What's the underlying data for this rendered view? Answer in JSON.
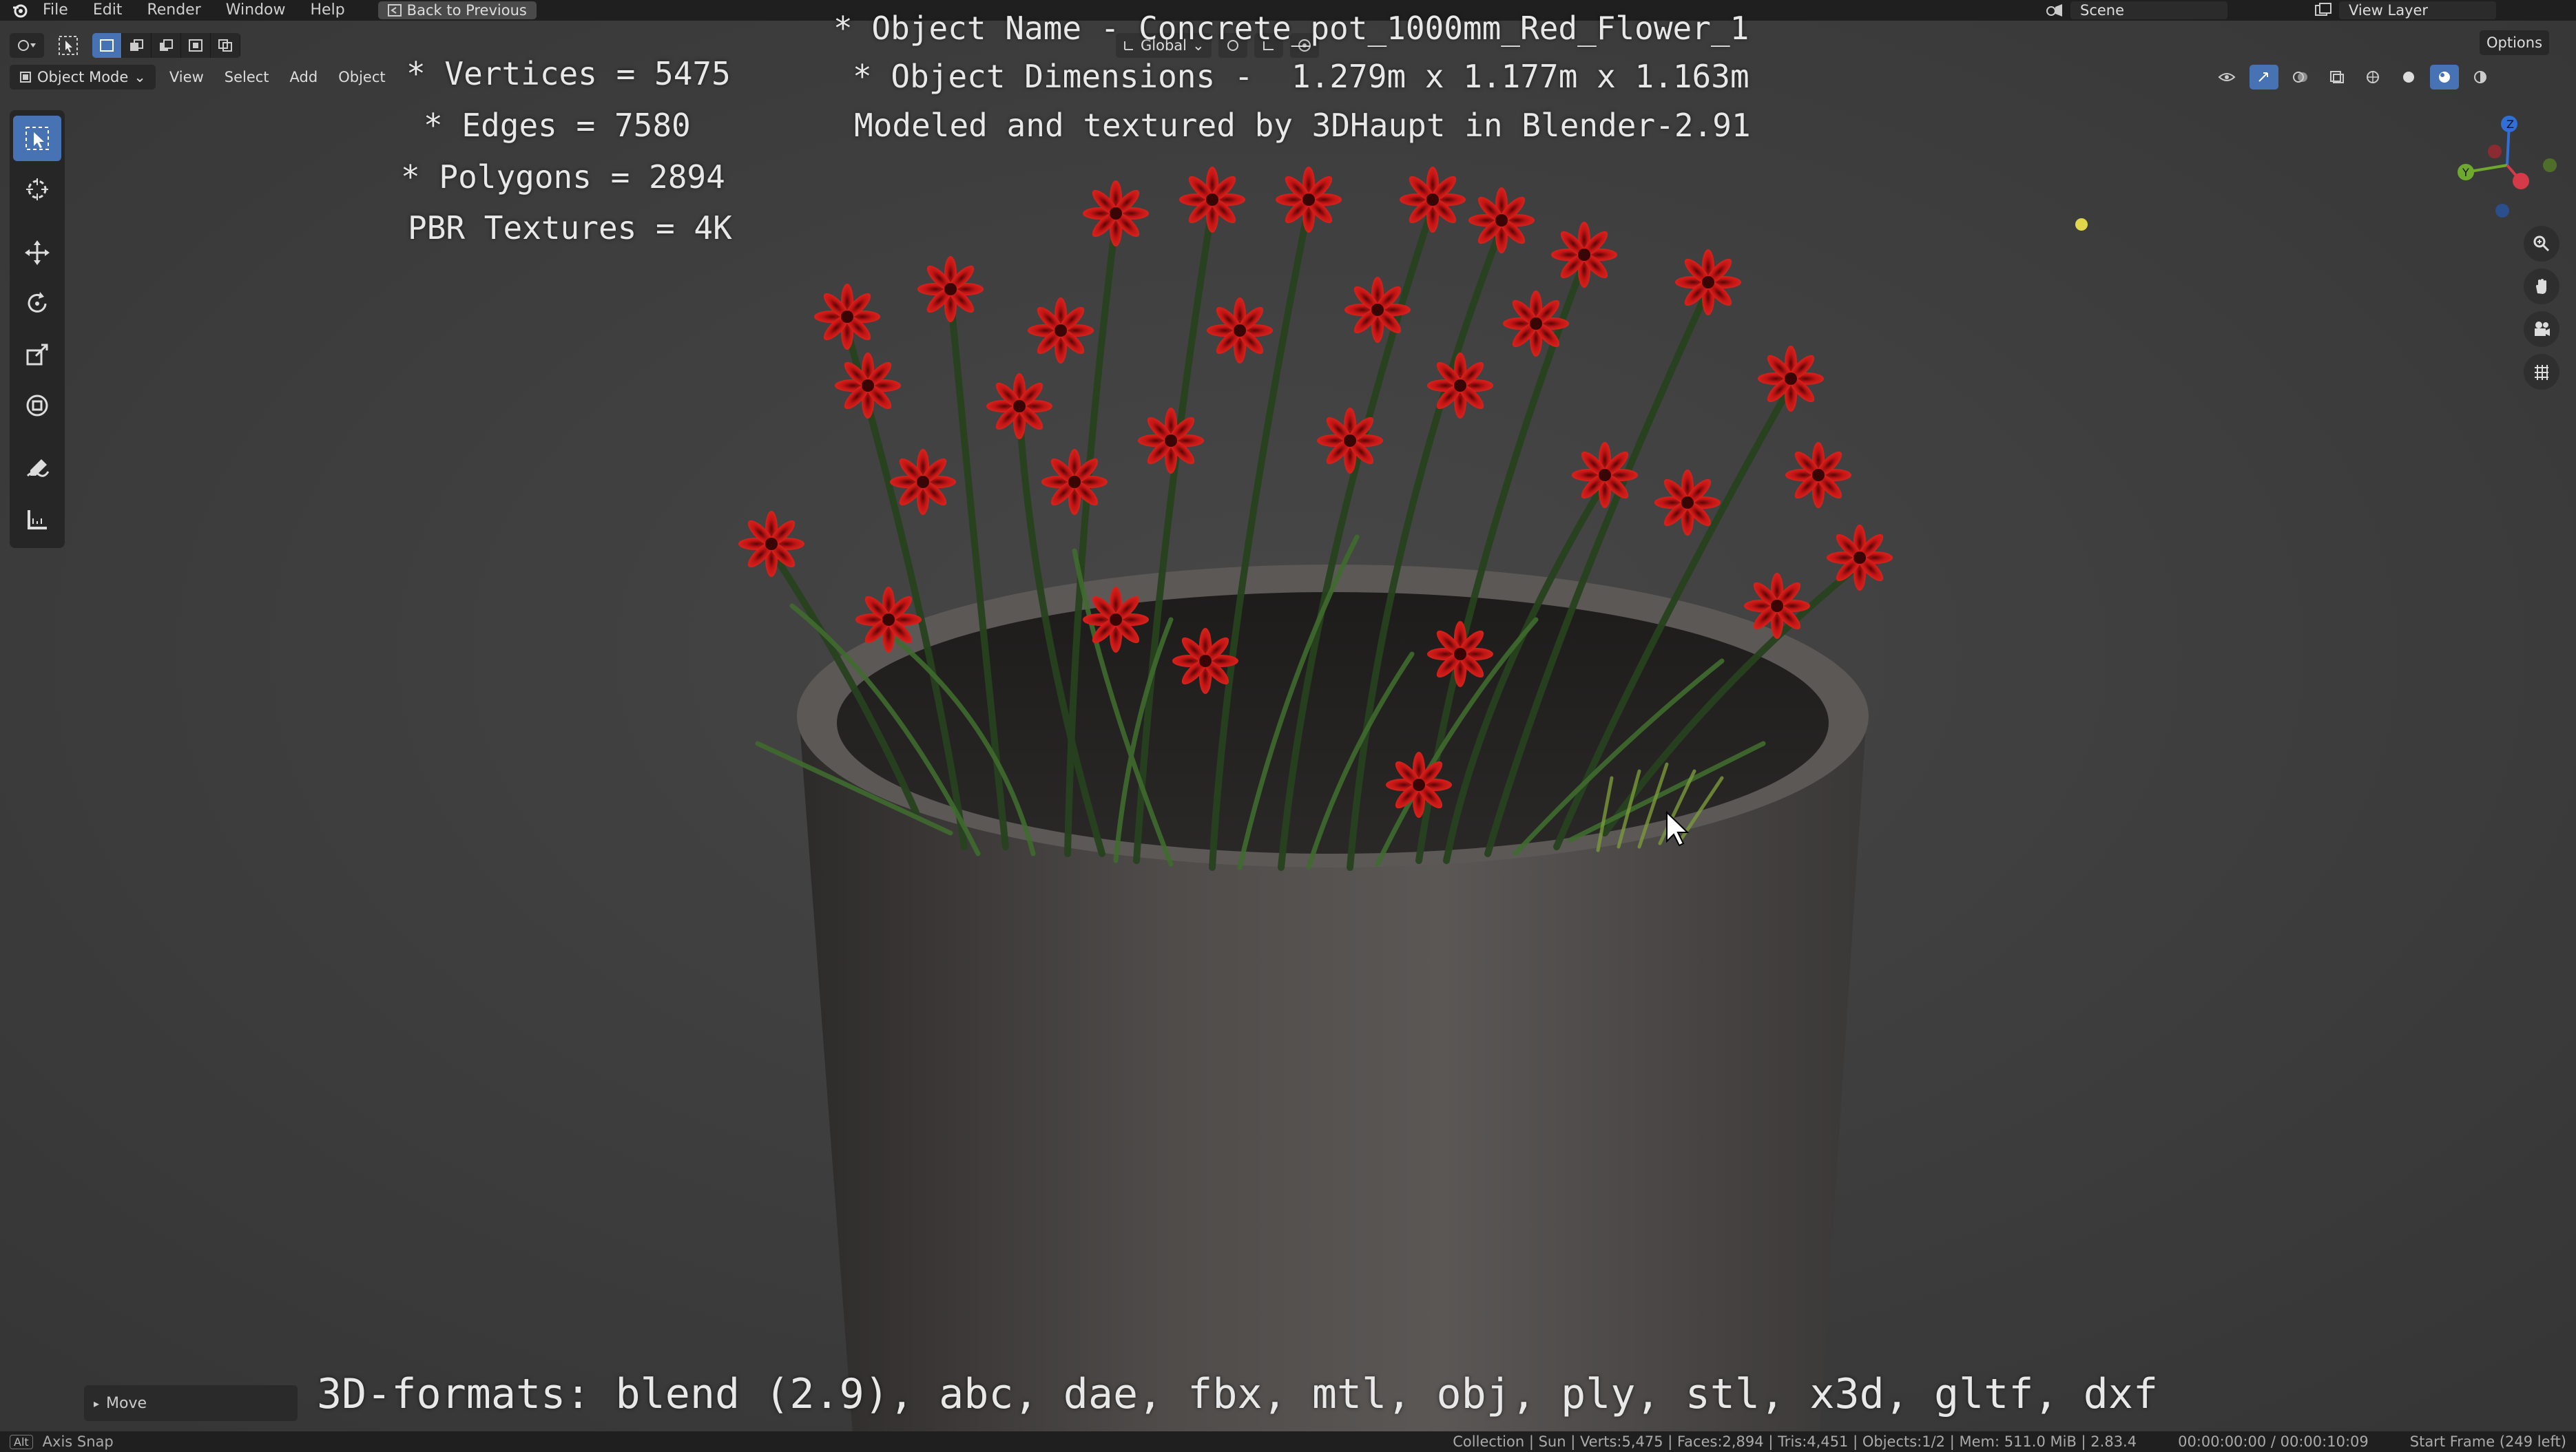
{
  "menubar": {
    "items": [
      "File",
      "Edit",
      "Render",
      "Window",
      "Help"
    ],
    "back_label": "Back to Previous",
    "scene_label": "Scene",
    "viewlayer_label": "View Layer"
  },
  "header": {
    "mode_label": "Object Mode",
    "menus": [
      "View",
      "Select",
      "Add",
      "Object"
    ],
    "transform_orientation": "Global",
    "options_label": "Options"
  },
  "overlay": {
    "vertices": "* Vertices = 5475",
    "edges": "* Edges = 7580",
    "polygons": "* Polygons = 2894",
    "textures": "PBR Textures = 4K",
    "object_name": "* Object Name - Concrete_pot_1000mm_Red_Flower_1",
    "object_dimensions": "* Object Dimensions -  1.279m x 1.177m x 1.163m",
    "credit": "Modeled and textured by 3DHaupt in Blender-2.91",
    "formats": "3D-formats: blend (2.9), abc, dae, fbx, mtl, obj, ply, stl, x3d, gltf, dxf"
  },
  "move_panel": {
    "label": "Move"
  },
  "statusbar": {
    "hint_key": "Alt",
    "hint_label": "Axis Snap",
    "stats": "Collection | Sun | Verts:5,475 | Faces:2,894 | Tris:4,451 | Objects:1/2 | Mem: 511.0 MiB | 2.83.4",
    "time": "00:00:00:00 / 00:00:10:09",
    "frame": "Start Frame (249 left)"
  },
  "colors": {
    "accent": "#4772b3",
    "viewport_bg": "#3d3d3d",
    "flower_red": "#c81818",
    "pot": "#4a4745"
  },
  "icons": [
    "blender-logo-icon",
    "back-icon",
    "scene-icon",
    "viewlayer-icon",
    "editor-type-icon",
    "select-box-icon",
    "cursor-icon",
    "move-icon",
    "rotate-icon",
    "scale-icon",
    "transform-icon",
    "annotate-icon",
    "measure-icon",
    "zoom-icon",
    "pan-hand-icon",
    "camera-icon",
    "grid-icon"
  ]
}
